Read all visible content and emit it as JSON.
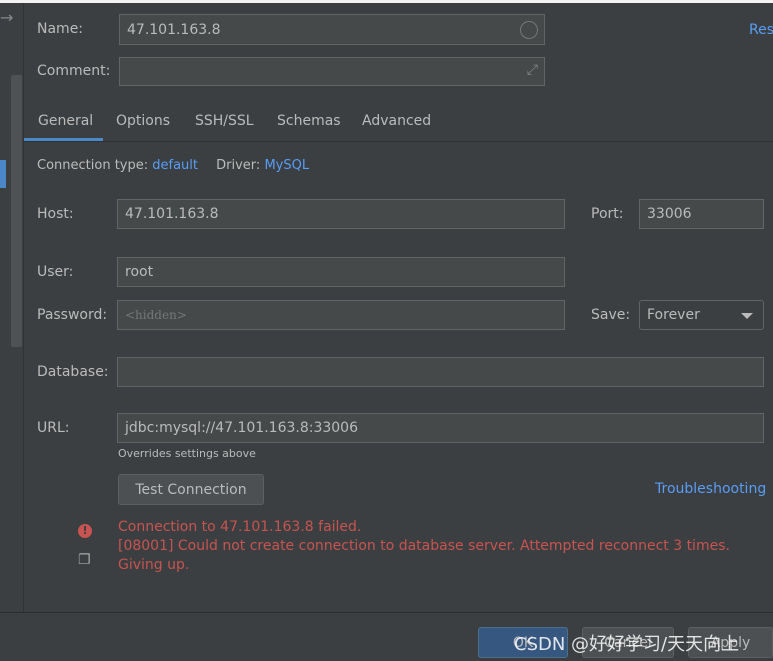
{
  "name": {
    "label": "Name:",
    "value": "47.101.163.8"
  },
  "comment": {
    "label": "Comment:",
    "value": ""
  },
  "reset_link": "Res",
  "tabs": [
    {
      "label": "General",
      "active": true
    },
    {
      "label": "Options"
    },
    {
      "label": "SSH/SSL"
    },
    {
      "label": "Schemas"
    },
    {
      "label": "Advanced"
    }
  ],
  "conn": {
    "type_label": "Connection type:",
    "type_value": "default",
    "driver_label": "Driver:",
    "driver_value": "MySQL"
  },
  "host": {
    "label": "Host:",
    "value": "47.101.163.8"
  },
  "port": {
    "label": "Port:",
    "value": "33006"
  },
  "user": {
    "label": "User:",
    "value": "root"
  },
  "password": {
    "label": "Password:",
    "placeholder": "<hidden>"
  },
  "save": {
    "label": "Save:",
    "value": "Forever"
  },
  "database": {
    "label": "Database:",
    "value": ""
  },
  "url": {
    "label": "URL:",
    "value": "jdbc:mysql://47.101.163.8:33006",
    "hint": "Overrides settings above"
  },
  "test_button": "Test Connection",
  "troubleshooting": "Troubleshooting",
  "error": {
    "line1": "Connection to 47.101.163.8 failed.",
    "line2": "[08001] Could not create connection to database server. Attempted reconnect 3 times. Giving up."
  },
  "footer": {
    "ok": "OK",
    "cancel": "Cancel",
    "apply": "Apply"
  },
  "watermark": "CSDN @好好学习/天天向上",
  "colors": {
    "accent": "#4a88c7",
    "link": "#589df6",
    "error": "#c75450"
  }
}
